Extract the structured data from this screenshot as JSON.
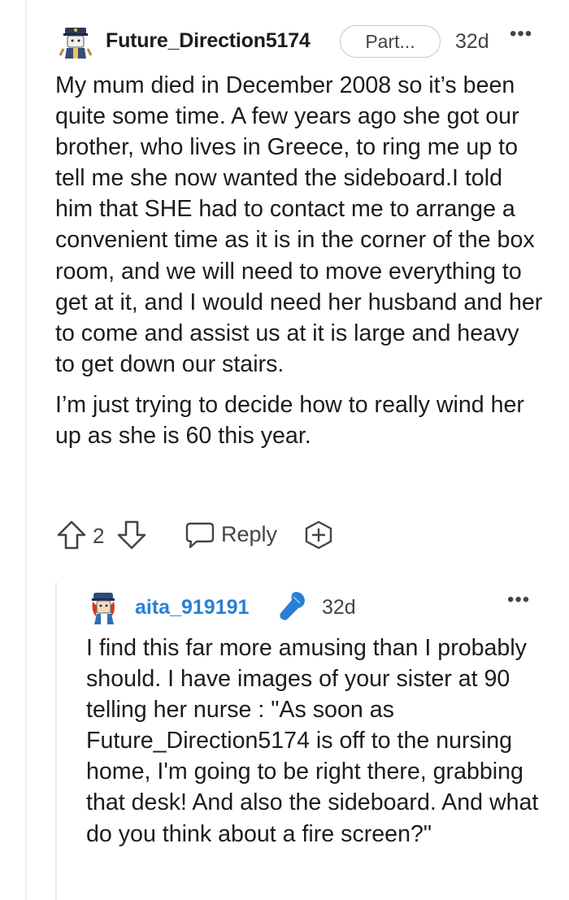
{
  "comment": {
    "username": "Future_Direction5174",
    "flair": "Part...",
    "age": "32d",
    "paragraphs": [
      "My mum died in December 2008 so it’s been quite some time. A few years ago she got our brother, who lives in Greece, to ring me up to tell me she now wanted the sideboard.I told him that SHE had to contact me to arrange a convenient time as it is in the corner of the box room, and we will need to move everything to get at it, and I would need her husband and her to come and assist us at it is large and heavy to get down our stairs.",
      "I’m just trying to decide how to really wind her up as she is 60 this year."
    ],
    "actions": {
      "vote_count": "2",
      "reply_label": "Reply"
    }
  },
  "reply": {
    "username": "aita_919191",
    "age": "32d",
    "body": "I find this far more amusing than I probably should. I have images of your sister at 90 telling her nurse : \"As soon as Future_Direction5174 is off to the nursing home, I'm going to be right there, grabbing that desk! And also the sideboard. And what do you think about a fire screen?\""
  },
  "icons": {
    "more": "more-options-icon",
    "upvote": "upvote-icon",
    "downvote": "downvote-icon",
    "reply": "reply-icon",
    "award": "award-icon",
    "mic": "microphone-icon"
  },
  "colors": {
    "reply_username": "#2a7fd4",
    "mic": "#2a7fd4",
    "text": "#1c1c1c",
    "muted": "#444444"
  }
}
